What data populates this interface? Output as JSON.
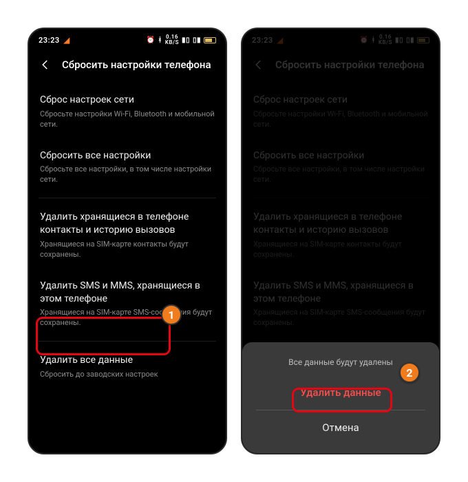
{
  "statusbar": {
    "time": "23:23",
    "speed_top": "0.16",
    "speed_unit": "KB/S"
  },
  "header": {
    "title": "Сбросить настройки телефона"
  },
  "items": {
    "net": {
      "title": "Сброс настроек сети",
      "sub": "Сбросьте настройки Wi-Fi, Bluetooth и мобильной сети."
    },
    "all_settings": {
      "title": "Сбросить все настройки",
      "sub": "Сбросьте все настройки, в том числе настройки сети."
    },
    "contacts": {
      "title": "Удалить хранящиеся в телефоне контакты и историю вызовов",
      "sub": "Хранящиеся на SIM-карте контакты будут сохранены."
    },
    "sms": {
      "title": "Удалить SMS и MMS, хранящиеся в этом телефоне",
      "sub": "Хранящиеся на SIM-карте SMS-сообщения будут сохранены."
    },
    "wipe": {
      "title": "Удалить все данные",
      "sub": "Сбросить до заводских настроек"
    }
  },
  "sheet": {
    "message": "Все данные будут удалены",
    "confirm": "Удалить данные",
    "cancel": "Отмена"
  },
  "badges": {
    "one": "1",
    "two": "2"
  }
}
